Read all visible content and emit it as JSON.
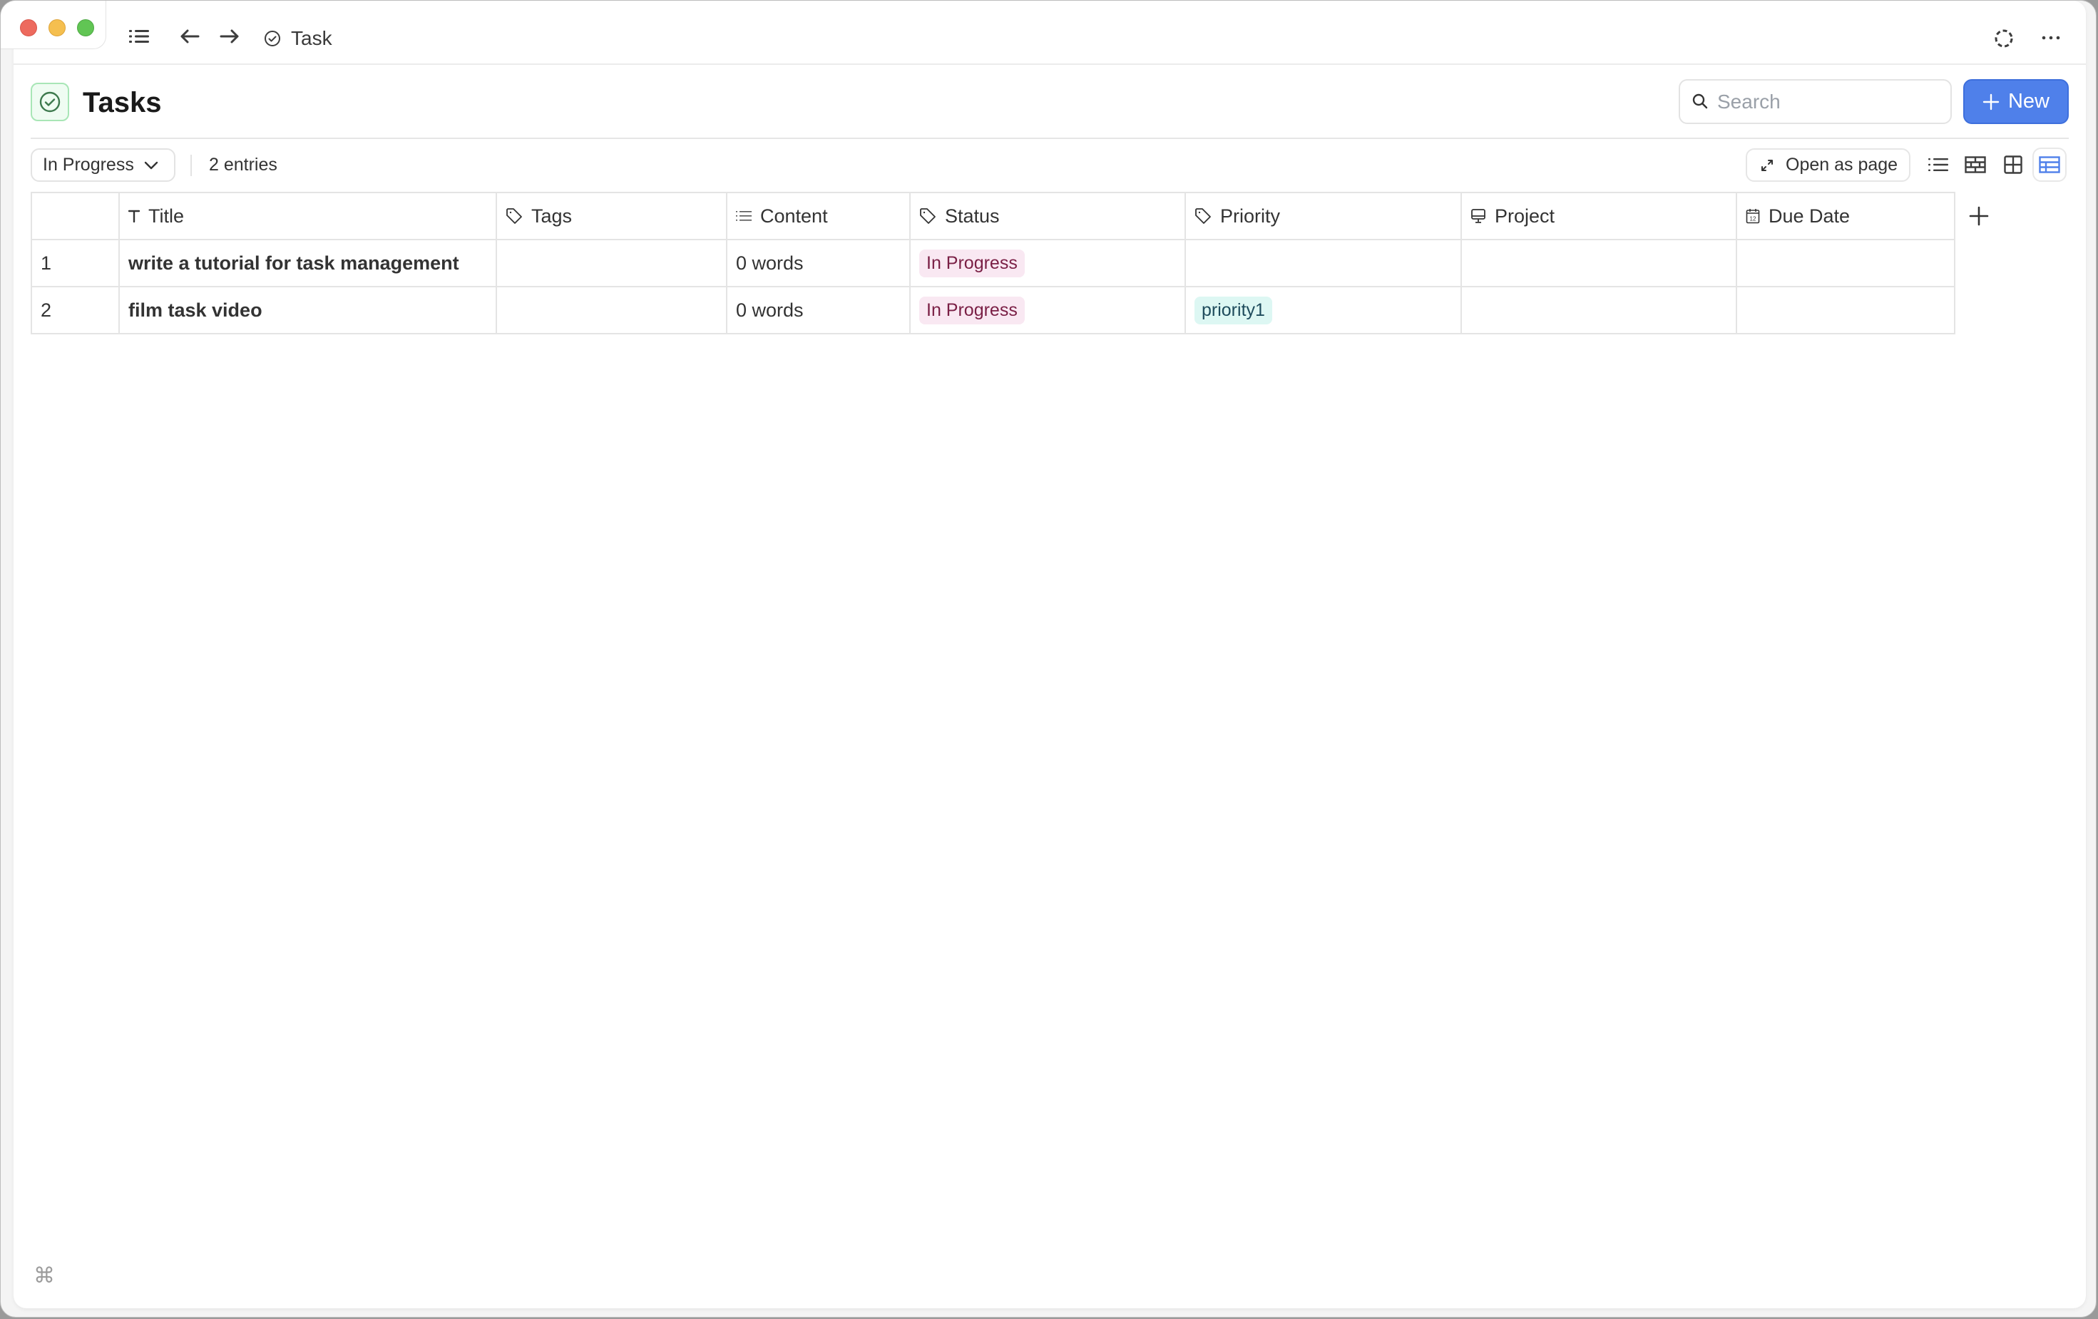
{
  "window": {
    "traffic_lights": [
      "close",
      "minimize",
      "zoom"
    ],
    "colors": {
      "close": "#ed6a5e",
      "minimize": "#f5bf4f",
      "zoom": "#61c554"
    }
  },
  "topbar": {
    "sidebar_toggle_icon": "list-icon",
    "back_icon": "arrow-left-icon",
    "forward_icon": "arrow-right-icon",
    "breadcrumb_icon": "check-circle-icon",
    "breadcrumb_label": "Task",
    "sync_icon": "dashed-circle-icon",
    "more_icon": "ellipsis-icon"
  },
  "header": {
    "icon": "check-circle-icon",
    "title": "Tasks",
    "search_placeholder": "Search",
    "new_button_label": "New",
    "accent_color": "#4f80ea"
  },
  "toolbar": {
    "filter_selected": "In Progress",
    "entries_count": "2 entries",
    "open_as_page_label": "Open as page",
    "views": [
      {
        "name": "list-view",
        "active": false
      },
      {
        "name": "gallery-view",
        "active": false
      },
      {
        "name": "board-view",
        "active": false
      },
      {
        "name": "table-view",
        "active": true
      }
    ]
  },
  "table": {
    "columns": [
      {
        "key": "title",
        "label": "Title",
        "icon": "text-icon"
      },
      {
        "key": "tags",
        "label": "Tags",
        "icon": "tag-icon"
      },
      {
        "key": "content",
        "label": "Content",
        "icon": "list-icon"
      },
      {
        "key": "status",
        "label": "Status",
        "icon": "tag-icon"
      },
      {
        "key": "priority",
        "label": "Priority",
        "icon": "tag-icon"
      },
      {
        "key": "project",
        "label": "Project",
        "icon": "monitor-icon"
      },
      {
        "key": "due_date",
        "label": "Due Date",
        "icon": "calendar-icon"
      }
    ],
    "rows": [
      {
        "num": "1",
        "title": "write a tutorial for task management",
        "tags": "",
        "content": "0 words",
        "status": "In Progress",
        "priority": "",
        "project": "",
        "due_date": ""
      },
      {
        "num": "2",
        "title": "film task video",
        "tags": "",
        "content": "0 words",
        "status": "In Progress",
        "priority": "priority1",
        "project": "",
        "due_date": ""
      }
    ],
    "badge_colors": {
      "status_bg": "#f9e8f2",
      "status_fg": "#7a1f45",
      "priority_bg": "#ddf7f3",
      "priority_fg": "#1e4b5c"
    }
  },
  "footer": {
    "shortcut_symbol": "⌘"
  }
}
